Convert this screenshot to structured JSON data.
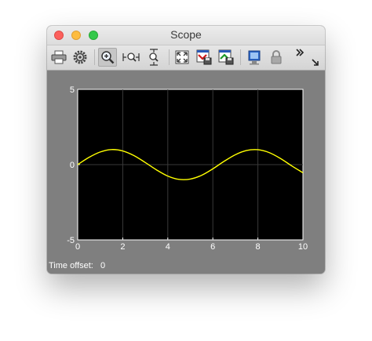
{
  "window": {
    "title": "Scope"
  },
  "toolbar": {
    "items": [
      {
        "icon": "print-icon"
      },
      {
        "icon": "gear-icon"
      },
      {
        "icon": "zoom-in-icon",
        "active": true
      },
      {
        "icon": "zoom-x-icon"
      },
      {
        "icon": "zoom-y-icon"
      },
      {
        "icon": "autoscale-icon"
      },
      {
        "icon": "save-axes-icon"
      },
      {
        "icon": "restore-axes-icon"
      },
      {
        "icon": "highlight-block-icon"
      },
      {
        "icon": "lock-icon"
      },
      {
        "icon": "more-icon"
      },
      {
        "icon": "undock-icon"
      }
    ]
  },
  "status": {
    "label": "Time offset:",
    "value": "0"
  },
  "chart_data": {
    "type": "line",
    "title": "",
    "xlabel": "",
    "ylabel": "",
    "xlim": [
      0,
      10
    ],
    "ylim": [
      -5,
      5
    ],
    "xticks": [
      "0",
      "2",
      "4",
      "6",
      "8",
      "10"
    ],
    "yticks": [
      "5",
      "0",
      "-5"
    ],
    "grid": true,
    "series": [
      {
        "color": "#ffff00",
        "x": [
          0,
          0.5,
          1,
          1.5,
          2,
          2.5,
          3,
          3.5,
          4,
          4.5,
          5,
          5.5,
          6,
          6.5,
          7,
          7.5,
          8,
          8.5,
          9,
          9.5,
          10
        ],
        "y": [
          0,
          0.48,
          0.84,
          1.0,
          0.91,
          0.6,
          0.14,
          -0.35,
          -0.76,
          -0.98,
          -0.96,
          -0.71,
          -0.28,
          0.22,
          0.66,
          0.94,
          0.99,
          0.8,
          0.41,
          -0.08,
          -0.54
        ]
      }
    ],
    "colors": {
      "background": "#000000",
      "grid": "#3a3a3a",
      "axes_bg": "#7f7f7f",
      "tick_text": "#ffffff"
    }
  }
}
